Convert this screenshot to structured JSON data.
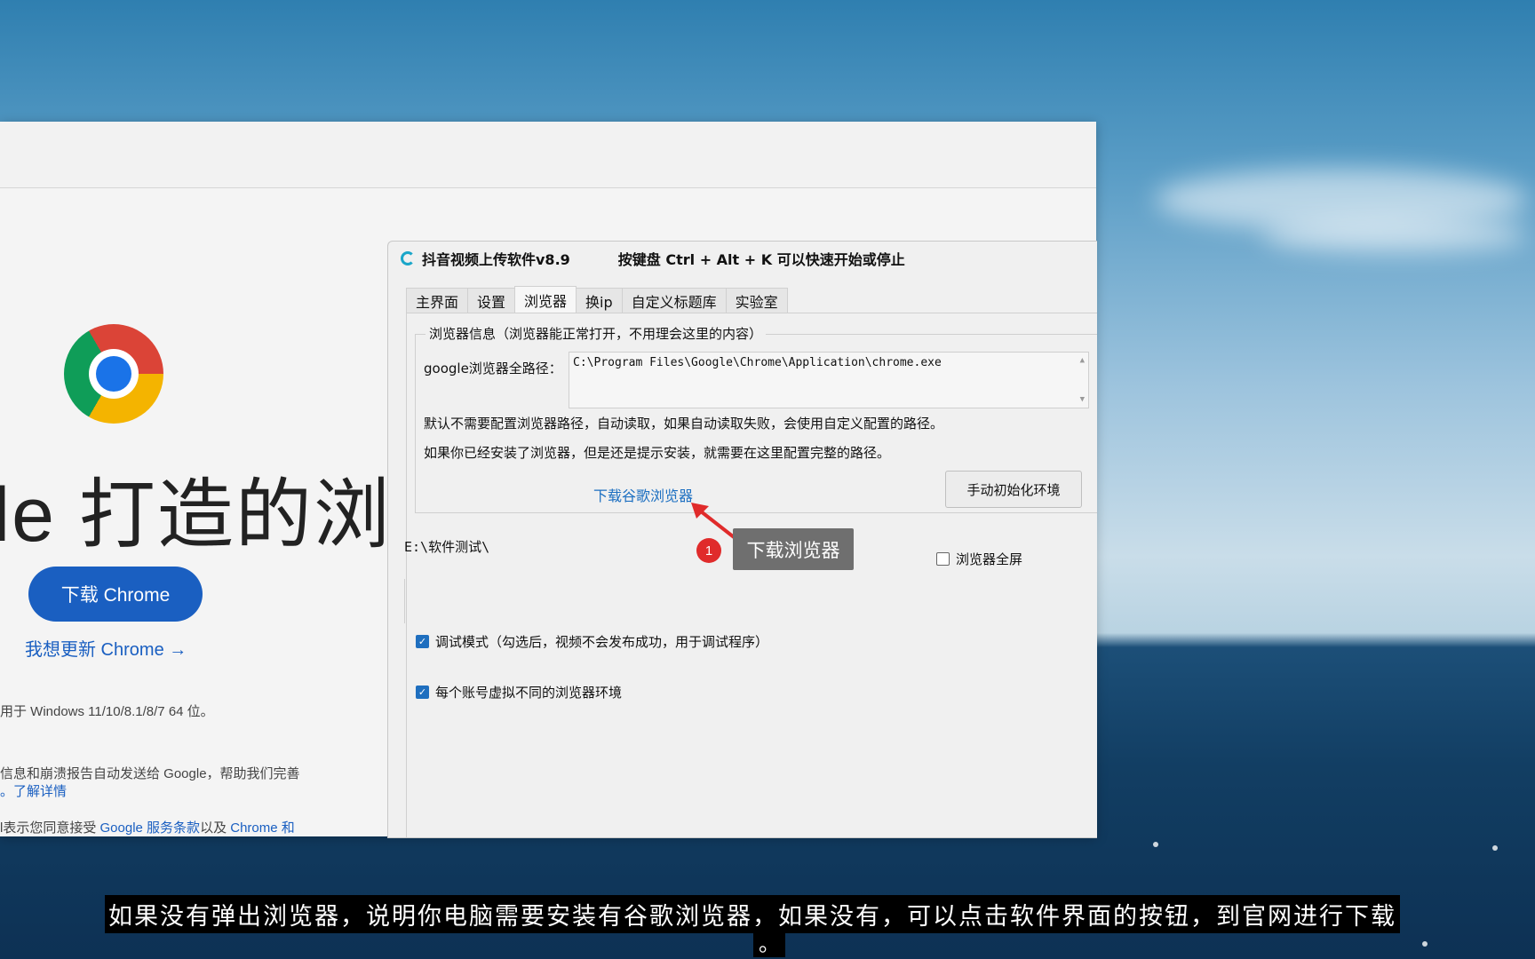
{
  "browser_page": {
    "headline": "le 打造的浏览",
    "download_button": "下载 Chrome",
    "update_link": "我想更新 Chrome →",
    "os_note": "用于 Windows 11/10/8.1/8/7 64 位。",
    "report_note": "信息和崩溃报告自动发送给 Google，帮助我们完善",
    "learn_more": "。了解详情",
    "terms_prefix": "l表示您同意接受 ",
    "terms_link": "Google 服务条款",
    "terms_mid": "以及 ",
    "terms_link2": "Chrome 和"
  },
  "app": {
    "title": "抖音视频上传软件v8.9",
    "hotkey_hint": "按键盘 Ctrl + Alt + K  可以快速开始或停止",
    "tabs": [
      "主界面",
      "设置",
      "浏览器",
      "换ip",
      "自定义标题库",
      "实验室"
    ],
    "active_tab": "浏览器",
    "group_title": "浏览器信息（浏览器能正常打开，不用理会这里的内容）",
    "path_label": "google浏览器全路径：",
    "path_value": "C:\\Program Files\\Google\\Chrome\\Application\\chrome.exe",
    "info_line1": "默认不需要配置浏览器路径，自动读取，如果自动读取失败，会使用自定义配置的路径。",
    "info_line2": "如果你已经安装了浏览器，但是还是提示安装，就需要在这里配置完整的路径。",
    "download_link": "下载谷歌浏览器",
    "init_button": "手动初始化环境",
    "folder_path": "E:\\软件测试\\",
    "fullscreen_label": "浏览器全屏",
    "fullscreen_checked": false,
    "debug_label": "调试模式（勾选后，视频不会发布成功，用于调试程序）",
    "debug_checked": true,
    "env_label": "每个账号虚拟不同的浏览器环境",
    "env_checked": true
  },
  "annotation": {
    "badge_number": "1",
    "tooltip": "下载浏览器",
    "arrow_color": "#e02b2b"
  },
  "subtitle": {
    "line1": "如果没有弹出浏览器，说明你电脑需要安装有谷歌浏览器，如果没有，可以点击软件界面的按钮，到官网进行下载",
    "line2": "。"
  },
  "icons": {
    "chrome_logo": "chrome-logo-icon",
    "app_icon": "app-logo-icon",
    "check": "✓"
  }
}
